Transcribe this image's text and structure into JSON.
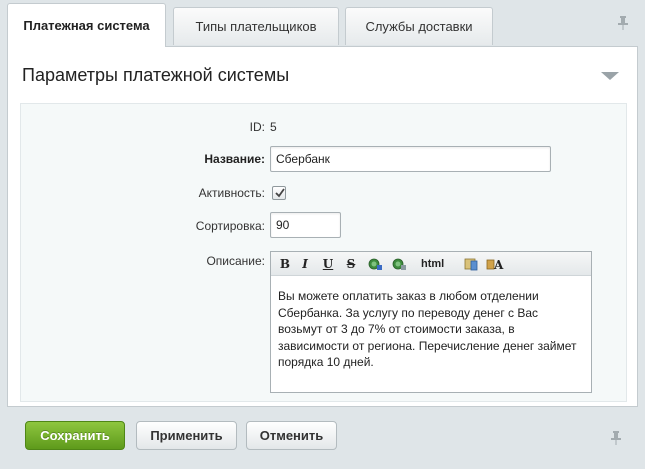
{
  "tabs": [
    {
      "label": "Платежная система",
      "active": true
    },
    {
      "label": "Типы плательщиков",
      "active": false
    },
    {
      "label": "Службы доставки",
      "active": false
    }
  ],
  "panel": {
    "title": "Параметры платежной системы"
  },
  "form": {
    "id_label": "ID:",
    "id_value": "5",
    "name_label": "Название:",
    "name_value": "Сбербанк",
    "active_label": "Активность:",
    "active_checked": true,
    "sort_label": "Сортировка:",
    "sort_value": "90",
    "description_label": "Описание:",
    "description_text": "Вы можете оплатить заказ в любом отделении Сбербанка. За услугу по переводу денег с Вас возьмут от 3 до 7% от стоимости заказа, в зависимости от региона. Перечисление денег займет порядка 10 дней."
  },
  "editor_toolbar": {
    "bold": "B",
    "italic": "I",
    "underline": "U",
    "strike": "S",
    "html": "html",
    "icons": [
      "bold-icon",
      "italic-icon",
      "underline-icon",
      "strikethrough-icon",
      "insert-link-icon",
      "remove-link-icon",
      "html-mode-icon",
      "insert-image-icon",
      "font-style-icon"
    ]
  },
  "buttons": {
    "save": "Сохранить",
    "apply": "Применить",
    "cancel": "Отменить"
  },
  "colors": {
    "background": "#dfe5e8",
    "primary_button": "#6fae28",
    "form_area": "#f5f9f9"
  }
}
